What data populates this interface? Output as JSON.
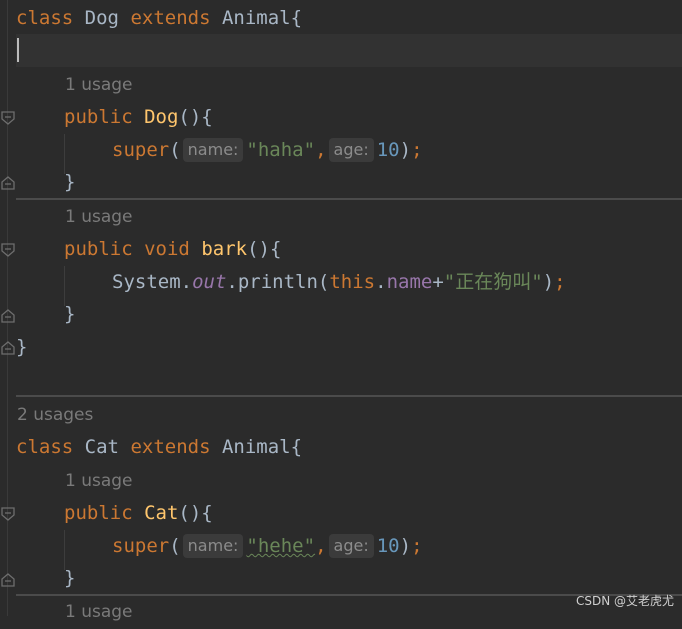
{
  "editor": {
    "lines": {
      "l1": {
        "kw": "class",
        "name": "Dog",
        "ext": "extends",
        "parent": "Animal",
        "brace": "{"
      },
      "dog_ctor": {
        "kw": "public",
        "name": "Dog",
        "paren": "(){"
      },
      "dog_super": {
        "call": "super",
        "open": "(",
        "hint1": "name:",
        "s": "\"haha\"",
        "comma": ",",
        "hint2": "age:",
        "n": "10",
        "close": ")",
        "semi": ";"
      },
      "close1": "}",
      "bark": {
        "kw1": "public",
        "kw2": "void",
        "name": "bark",
        "paren": "(){"
      },
      "bark_body": {
        "obj": "System.",
        "field": "out",
        "call": ".println(",
        "self": "this",
        "dot": ".",
        "fname": "name",
        "plus": "+",
        "s": "\"正在狗叫\"",
        "close": ")",
        "semi": ";"
      },
      "close2": "}",
      "close_dog": "}",
      "cat": {
        "kw": "class",
        "name": "Cat",
        "ext": "extends",
        "parent": "Animal",
        "brace": "{"
      },
      "cat_ctor": {
        "kw": "public",
        "name": "Cat",
        "paren": "(){"
      },
      "cat_super": {
        "call": "super",
        "open": "(",
        "hint1": "name:",
        "s": "\"hehe\"",
        "comma": ",",
        "hint2": "age:",
        "n": "10",
        "close": ")",
        "semi": ";"
      },
      "close3": "}"
    },
    "usages": {
      "dog_ctor": "1 usage",
      "bark": "1 usage",
      "cat": "2 usages",
      "cat_ctor": "1 usage",
      "next": "1 usage"
    }
  },
  "watermark": "CSDN @艾老虎尤"
}
